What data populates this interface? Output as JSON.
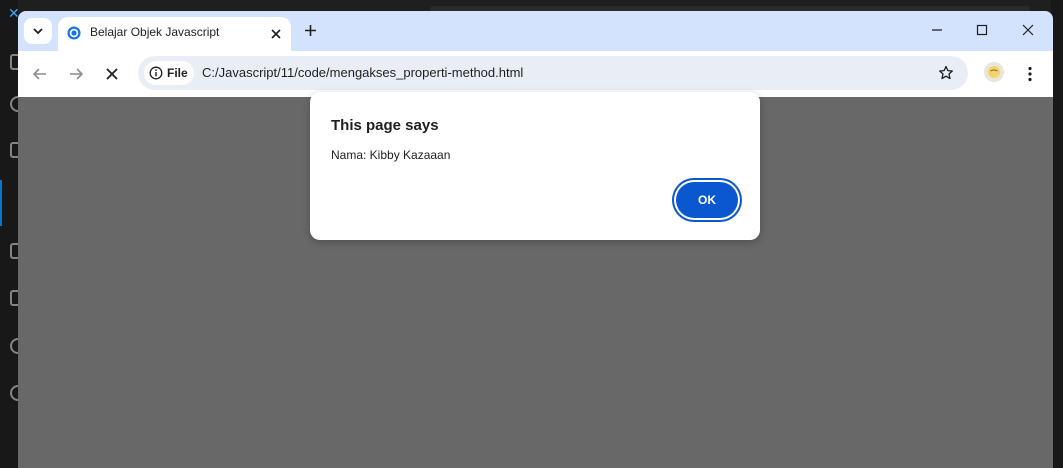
{
  "browser": {
    "tab": {
      "title": "Belajar Objek Javascript",
      "favicon": "chrome-icon"
    },
    "address_bar": {
      "site_chip_label": "File",
      "url": "C:/Javascript/11/code/mengakses_properti-method.html"
    },
    "icons": {
      "tab_search": "chevron-down-icon",
      "tab_close": "close-icon",
      "new_tab": "plus-icon",
      "minimize": "minimize-icon",
      "maximize": "maximize-icon",
      "window_close": "close-icon",
      "back": "arrow-left-icon",
      "forward": "arrow-right-icon",
      "stop": "stop-icon",
      "site_info": "info-icon",
      "bookmark": "star-icon",
      "profile": "avatar",
      "menu": "kebab-menu-icon"
    }
  },
  "dialog": {
    "title": "This page says",
    "message": "Nama: Kibby Kazaaan",
    "ok_label": "OK"
  },
  "colors": {
    "tabstrip": "#d3e3fd",
    "page_overlay": "#686868",
    "accent": "#0b57d0"
  }
}
